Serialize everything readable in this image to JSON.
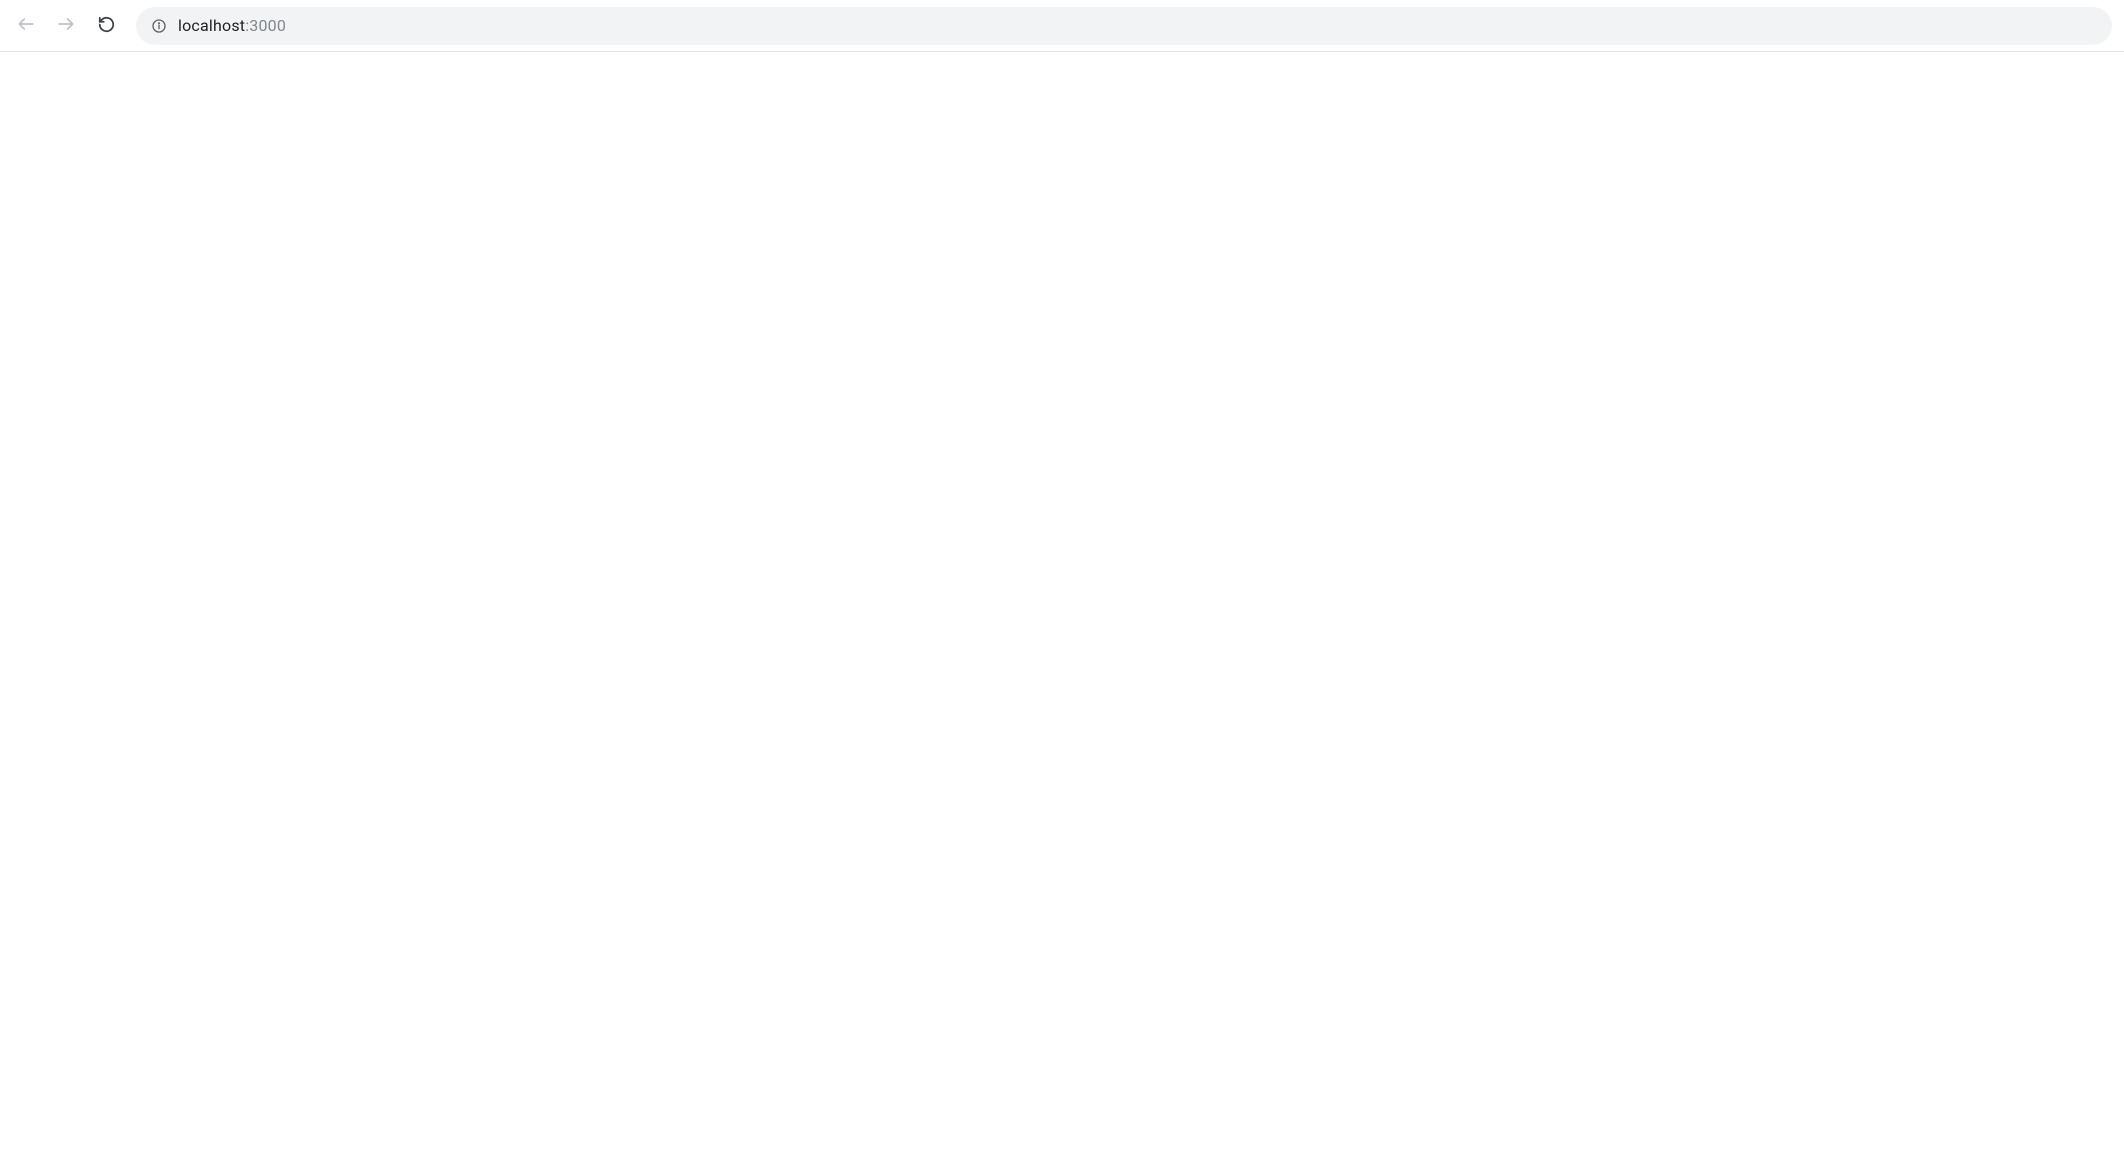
{
  "browser": {
    "nav": {
      "back_enabled": false,
      "forward_enabled": false,
      "reload_label": "Reload"
    },
    "address_bar": {
      "url_host": "localhost",
      "url_port": ":3000"
    }
  }
}
